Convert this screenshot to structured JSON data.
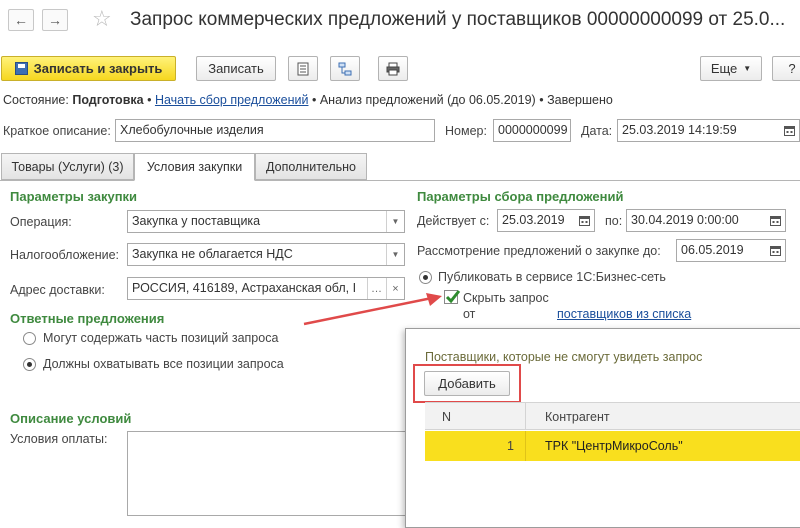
{
  "window": {
    "title": "Запрос коммерческих предложений у поставщиков 00000000099 от 25.0..."
  },
  "toolbar": {
    "save_close": "Записать и закрыть",
    "save": "Записать",
    "more": "Еще"
  },
  "status": {
    "label": "Состояние:",
    "current": "Подготовка",
    "sep1": "•",
    "step2": "Начать сбор предложений",
    "sep2": "•",
    "step3": "Анализ предложений (до 06.05.2019)",
    "sep3": "•",
    "step4": "Завершено"
  },
  "header": {
    "short_desc_label": "Краткое описание:",
    "short_desc_value": "Хлебобулочные изделия",
    "number_label": "Номер:",
    "number_value": "0000000099",
    "date_label": "Дата:",
    "date_value": "25.03.2019 14:19:59"
  },
  "tabs": [
    {
      "label": "Товары (Услуги) (3)"
    },
    {
      "label": "Условия закупки"
    },
    {
      "label": "Дополнительно"
    }
  ],
  "purchase": {
    "section": "Параметры закупки",
    "operation_label": "Операция:",
    "operation_value": "Закупка у поставщика",
    "tax_label": "Налогообложение:",
    "tax_value": "Закупка не облагается НДС",
    "address_label": "Адрес доставки:",
    "address_value": "РОССИЯ, 416189, Астраханская обл, I"
  },
  "collection": {
    "section": "Параметры сбора предложений",
    "valid_label": "Действует с:",
    "valid_from": "25.03.2019",
    "to_label": "по:",
    "valid_to": "30.04.2019  0:00:00",
    "review_label": "Рассмотрение предложений о закупке до:",
    "review_value": "06.05.2019",
    "publish_label": "Публиковать в сервисе 1С:Бизнес-сеть",
    "hide_label_1": "Скрыть запрос",
    "hide_label_2": "от",
    "hide_link": "поставщиков из списка"
  },
  "responses": {
    "section": "Ответные предложения",
    "opt1": "Могут содержать часть позиций запроса",
    "opt2": "Должны охватывать все позиции запроса"
  },
  "conditions": {
    "section": "Описание условий",
    "payment_label": "Условия оплаты:"
  },
  "popup": {
    "caption": "Поставщики, которые не смогут увидеть запрос",
    "add_button": "Добавить",
    "col_n": "N",
    "col_counterparty": "Контрагент",
    "rows": [
      {
        "n": "1",
        "name": "ТРК \"ЦентрМикроСоль\""
      }
    ]
  },
  "colors": {
    "accent_green": "#3f8a3f",
    "link_blue": "#1a4e9b",
    "highlight_yellow": "#f9df1e",
    "annotation_red": "#e04a4a"
  }
}
